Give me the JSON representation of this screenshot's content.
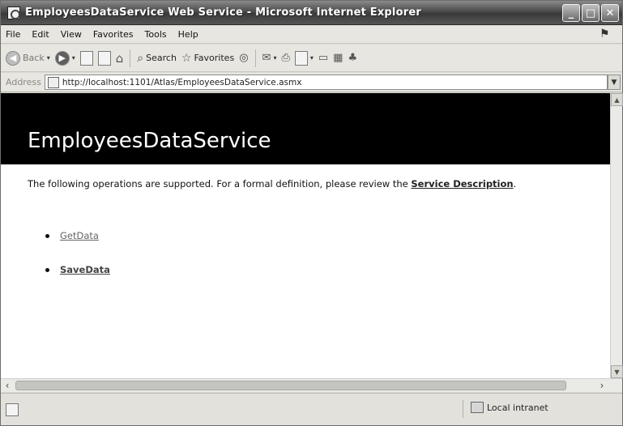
{
  "window": {
    "title": "EmployeesDataService Web Service - Microsoft Internet Explorer",
    "controls": [
      "_",
      "□",
      "✕"
    ]
  },
  "menu": [
    "File",
    "Edit",
    "View",
    "Favorites",
    "Tools",
    "Help"
  ],
  "toolbar": {
    "back_label": "Back",
    "search_label": "Search",
    "favorites_label": "Favorites"
  },
  "address": {
    "label": "Address",
    "url": "http://localhost:1101/Atlas/EmployeesDataService.asmx"
  },
  "page": {
    "heading": "EmployeesDataService",
    "intro_text": "The following operations are supported. For a formal definition, please review the",
    "service_description_link": "Service Description",
    "intro_suffix": ".",
    "operations": [
      "GetData",
      "SaveData"
    ]
  },
  "status": {
    "zone": "Local intranet"
  },
  "icons": {
    "back": "back-arrow-icon",
    "forward": "forward-arrow-icon",
    "stop": "stop-icon",
    "refresh": "refresh-icon",
    "home": "home-icon",
    "search": "search-icon",
    "favorites": "star-icon",
    "media": "media-icon",
    "mail": "mail-icon",
    "print": "print-icon",
    "edit": "edit-icon",
    "messenger": "messenger-icon"
  }
}
